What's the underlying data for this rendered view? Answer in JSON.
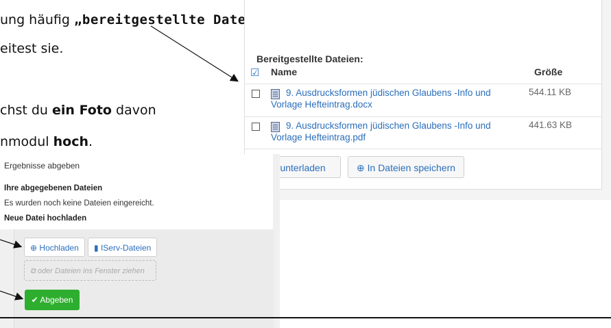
{
  "instructions": {
    "line1_prefix": "ung häufig ",
    "line1_bold": "„bereitgestellte Dateien“",
    "line2": "eitest sie.",
    "line3_prefix": "chst du ",
    "line3_bold": "ein Foto",
    "line3_suffix": " davon",
    "line4_prefix": "nmodul ",
    "line4_bold": "hoch",
    "line4_suffix": "."
  },
  "files_panel": {
    "title": "Bereitgestellte Dateien:",
    "col_name": "Name",
    "col_size": "Größe",
    "files": [
      {
        "name": "9. Ausdrucksformen jüdischen Glaubens -Info und Vorlage Hefteintrag.docx",
        "size": "544.11 KB"
      },
      {
        "name": "9. Ausdrucksformen jüdischen Glaubens -Info und Vorlage Hefteintrag.pdf",
        "size": "441.63 KB"
      }
    ],
    "download_button": "erunterladen",
    "save_button": "In Dateien speichern"
  },
  "upload_panel": {
    "title": "Ergebnisse abgeben",
    "submitted_heading": "Ihre abgegebenen Dateien",
    "submitted_text": "Es wurden noch keine Dateien eingereicht.",
    "new_file_heading": "Neue Datei hochladen",
    "upload_button": "Hochladen",
    "iserv_button": "IServ-Dateien",
    "drop_zone": "oder Dateien ins Fenster ziehen",
    "submit_button": "Abgeben"
  },
  "colors": {
    "link": "#2a6ebb",
    "submit_green": "#2eae2e"
  },
  "icons": [
    "check-square-icon",
    "document-icon",
    "download-circle-icon",
    "upload-circle-icon",
    "file-icon",
    "copy-icon",
    "checkmark-icon",
    "arrow-icon"
  ]
}
